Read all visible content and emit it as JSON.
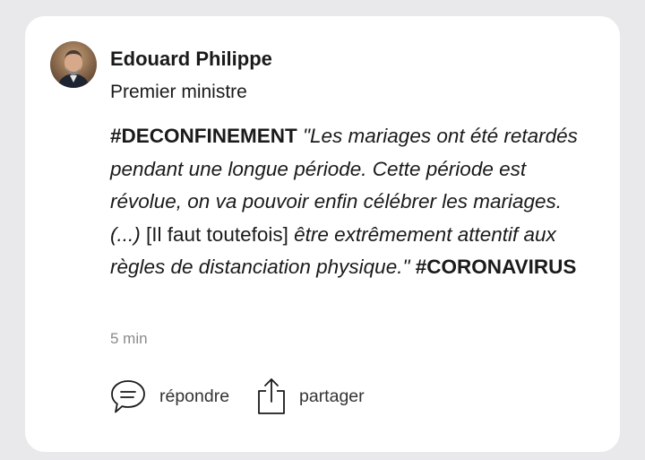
{
  "author": {
    "name": "Edouard Philippe",
    "role": "Premier ministre"
  },
  "post": {
    "hashtag_start": "#DECONFINEMENT",
    "quote_part1": "\"Les mariages ont été retardés pendant une longue période. Cette période est révolue, on va pouvoir enfin célébrer les mariages. (...)",
    "bracket": "[Il faut toutefois]",
    "quote_part2": "être extrêmement attentif aux règles de distanciation physique.\"",
    "hashtag_end": "#CORONAVIRUS"
  },
  "timestamp": "5 min",
  "actions": {
    "reply_label": "répondre",
    "share_label": "partager"
  },
  "icons": {
    "avatar": "author-photo",
    "reply": "speech-bubble-icon",
    "share": "share-upload-icon"
  },
  "colors": {
    "background": "#e9e9ec",
    "card": "#ffffff",
    "text": "#1a1a1a",
    "muted": "#8a8a8a"
  }
}
